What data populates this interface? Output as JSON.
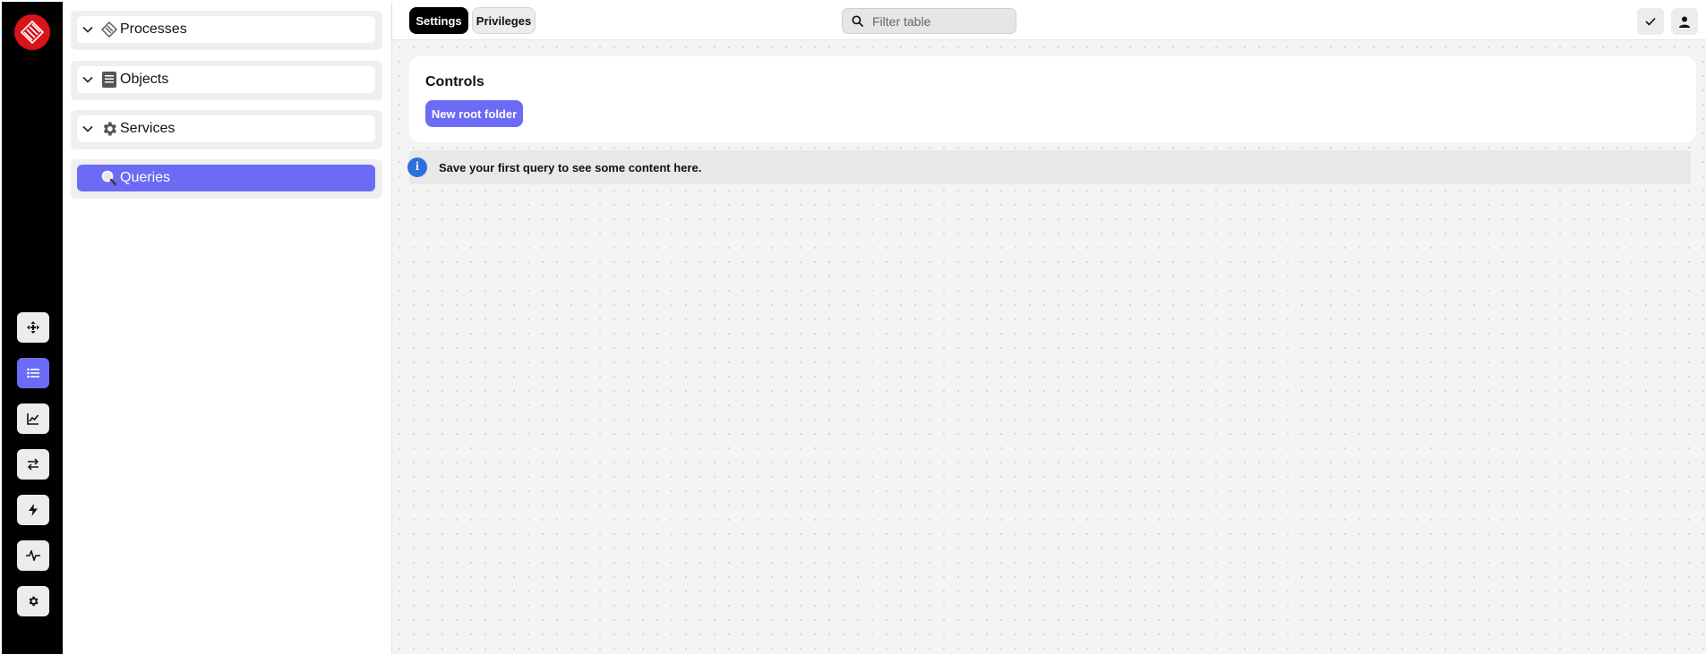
{
  "rail": {
    "items": [
      {
        "name": "move-icon",
        "active": false
      },
      {
        "name": "list-icon",
        "active": true
      },
      {
        "name": "chart-line-icon",
        "active": false
      },
      {
        "name": "swap-arrows-icon",
        "active": false
      },
      {
        "name": "lightning-icon",
        "active": false
      },
      {
        "name": "pulse-icon",
        "active": false
      },
      {
        "name": "gear-icon",
        "active": false
      }
    ]
  },
  "nav": {
    "items": [
      {
        "label": "Processes",
        "icon": "processes-icon",
        "expanded": false
      },
      {
        "label": "Objects",
        "icon": "document-icon",
        "expanded": false
      },
      {
        "label": "Services",
        "icon": "gear-icon",
        "expanded": false
      },
      {
        "label": "Queries",
        "icon": "magnifier-icon",
        "active": true
      }
    ]
  },
  "topbar": {
    "tabs": [
      {
        "label": "Settings",
        "active": true
      },
      {
        "label": "Privileges",
        "active": false
      }
    ],
    "search": {
      "placeholder": "Filter table",
      "value": ""
    }
  },
  "main": {
    "controls_title": "Controls",
    "new_folder_label": "New root folder",
    "info_icon_glyph": "i",
    "info_text": "Save your first query to see some content here."
  },
  "colors": {
    "accent": "#6b6bf5",
    "brand": "#d7141a",
    "info": "#2d6fdc"
  }
}
